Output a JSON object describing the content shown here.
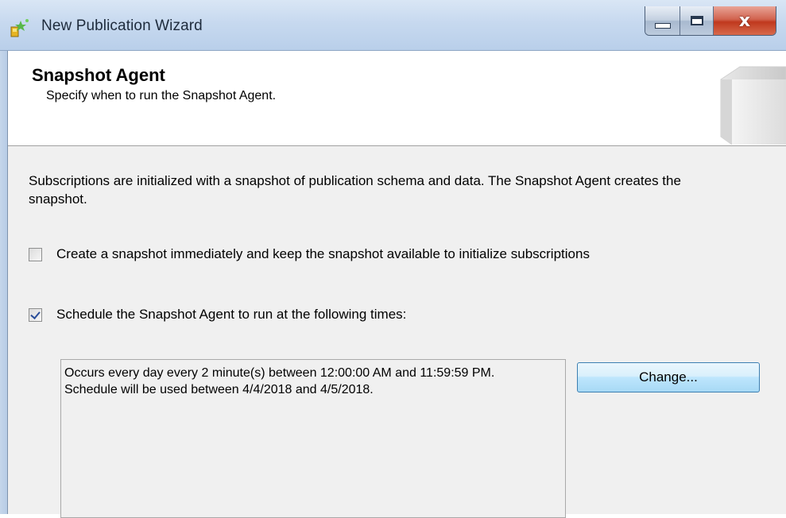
{
  "window": {
    "title": "New Publication Wizard",
    "close_glyph": "x"
  },
  "header": {
    "title": "Snapshot Agent",
    "subtitle": "Specify when to run the Snapshot Agent."
  },
  "content": {
    "intro": "Subscriptions are initialized with a snapshot of publication schema and data. The Snapshot Agent creates the snapshot.",
    "options": [
      {
        "label": "Create a snapshot immediately and keep the snapshot available to initialize subscriptions",
        "checked": false
      },
      {
        "label": "Schedule the Snapshot Agent to run at the following times:",
        "checked": true
      }
    ],
    "schedule_description": "Occurs every day every 2 minute(s) between 12:00:00 AM and 11:59:59 PM. Schedule will be used between 4/4/2018 and 4/5/2018.",
    "change_button_label": "Change..."
  },
  "icons": [
    "wizard-app-icon",
    "minimize-icon",
    "maximize-icon",
    "close-icon",
    "book-graphic"
  ],
  "colors": {
    "titlebar": "#c7d9ef",
    "close_button": "#c0391e",
    "body_background": "#f0f0f0",
    "checkbox_check": "#2a4e9a",
    "button_border": "#3c7fb1"
  }
}
